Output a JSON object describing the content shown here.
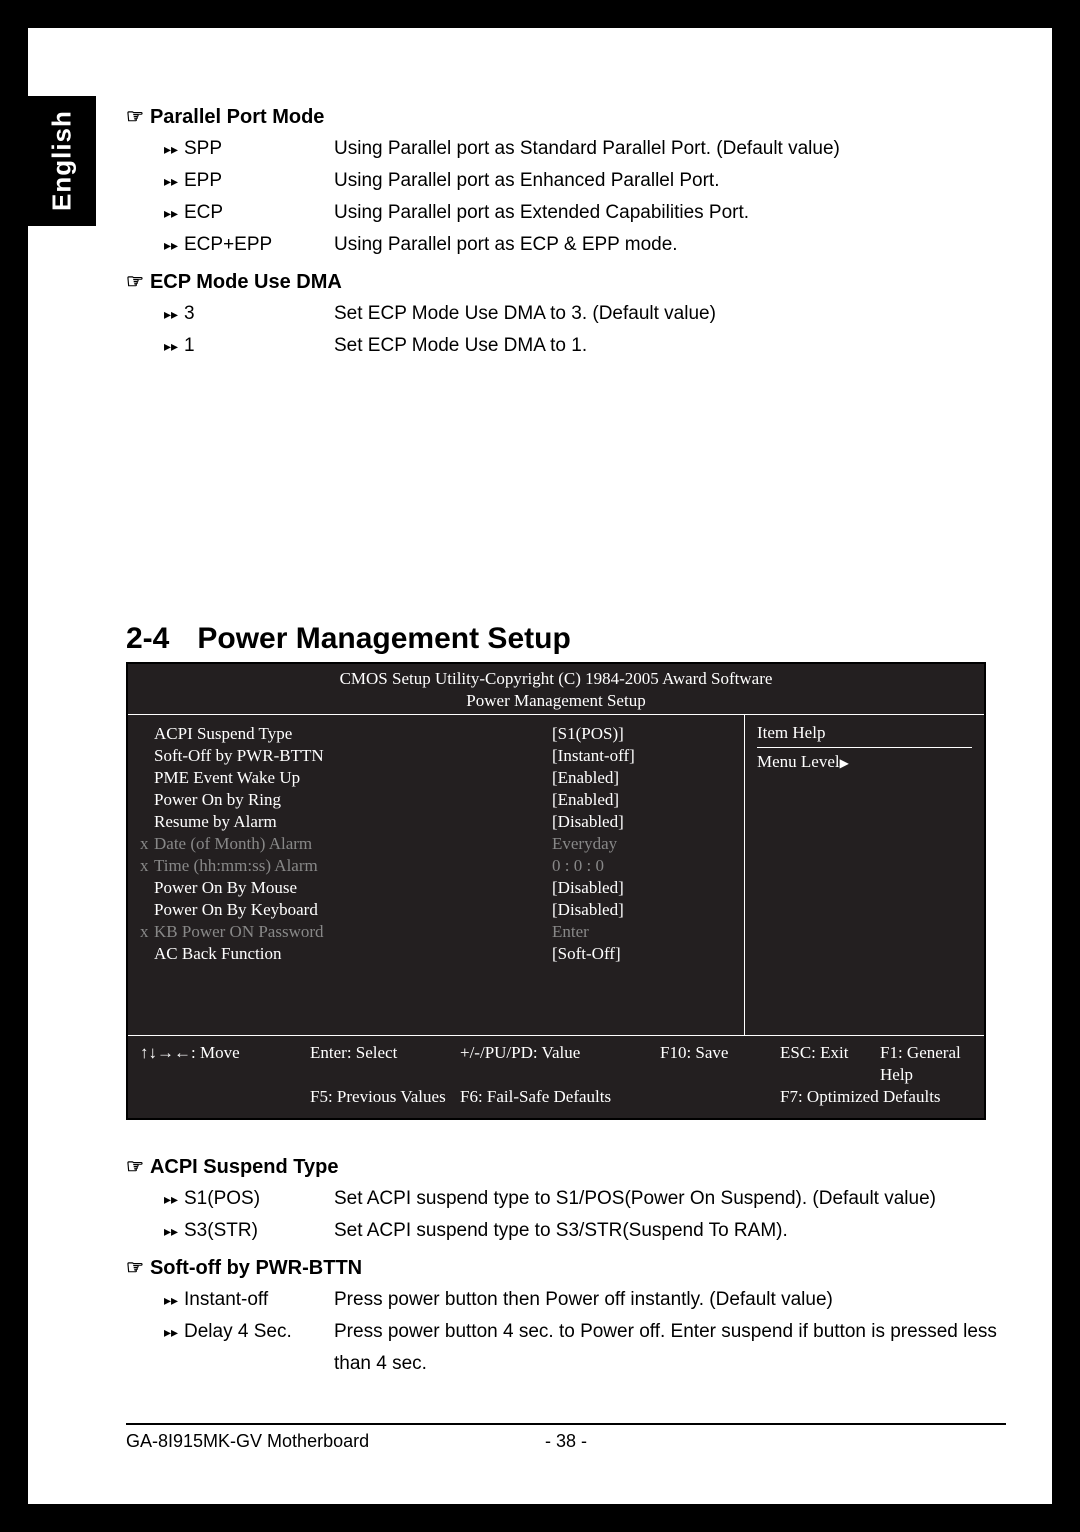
{
  "langTab": "English",
  "sections": [
    {
      "title": "Parallel Port Mode",
      "options": [
        {
          "label": "SPP",
          "desc": "Using Parallel port as Standard Parallel Port. (Default value)"
        },
        {
          "label": "EPP",
          "desc": "Using Parallel port as Enhanced Parallel Port."
        },
        {
          "label": "ECP",
          "desc": "Using Parallel port as Extended Capabilities Port."
        },
        {
          "label": "ECP+EPP",
          "desc": "Using Parallel port as ECP & EPP mode."
        }
      ]
    },
    {
      "title": "ECP Mode Use DMA",
      "options": [
        {
          "label": "3",
          "desc": "Set ECP Mode Use DMA to 3. (Default value)"
        },
        {
          "label": "1",
          "desc": "Set ECP Mode Use DMA to 1."
        }
      ]
    }
  ],
  "chapter": {
    "num": "2-4",
    "title": "Power Management Setup"
  },
  "bios": {
    "header1": "CMOS Setup Utility-Copyright (C) 1984-2005 Award Software",
    "header2": "Power Management Setup",
    "items": [
      {
        "x": false,
        "name": "ACPI Suspend Type",
        "value": "[S1(POS)]",
        "dim": false
      },
      {
        "x": false,
        "name": "Soft-Off by PWR-BTTN",
        "value": "[Instant-off]",
        "dim": false
      },
      {
        "x": false,
        "name": "PME Event Wake Up",
        "value": "[Enabled]",
        "dim": false
      },
      {
        "x": false,
        "name": "Power On by Ring",
        "value": "[Enabled]",
        "dim": false
      },
      {
        "x": false,
        "name": "Resume by Alarm",
        "value": "[Disabled]",
        "dim": false
      },
      {
        "x": true,
        "name": "Date (of Month) Alarm",
        "value": "Everyday",
        "dim": true
      },
      {
        "x": true,
        "name": "Time (hh:mm:ss) Alarm",
        "value": "0 : 0 : 0",
        "dim": true
      },
      {
        "x": false,
        "name": "Power On By Mouse",
        "value": "[Disabled]",
        "dim": false
      },
      {
        "x": false,
        "name": "Power On By Keyboard",
        "value": "[Disabled]",
        "dim": false
      },
      {
        "x": true,
        "name": "KB Power ON Password",
        "value": "Enter",
        "dim": true
      },
      {
        "x": false,
        "name": "AC Back Function",
        "value": "[Soft-Off]",
        "dim": false
      }
    ],
    "help": {
      "title": "Item Help",
      "menu": "Menu Level"
    },
    "footer": {
      "r1c1": "↑↓→←: Move",
      "r1c2": "Enter: Select",
      "r1c3": "+/-/PU/PD: Value",
      "r1c4": "F10: Save",
      "r1c5": "ESC: Exit",
      "r1c6": "F1: General Help",
      "r2c1": "",
      "r2c2": "F5: Previous Values",
      "r2c3": "F6: Fail-Safe Defaults",
      "r2c4": "",
      "r2c5": "F7: Optimized Defaults",
      "r2c6": ""
    }
  },
  "postSections": [
    {
      "title": "ACPI Suspend Type",
      "options": [
        {
          "label": "S1(POS)",
          "desc": "Set ACPI suspend type to S1/POS(Power On Suspend). (Default value)"
        },
        {
          "label": "S3(STR)",
          "desc": "Set ACPI suspend type to S3/STR(Suspend To RAM)."
        }
      ]
    },
    {
      "title": "Soft-off by PWR-BTTN",
      "options": [
        {
          "label": "Instant-off",
          "desc": "Press power button then Power off instantly. (Default value)"
        },
        {
          "label": "Delay 4 Sec.",
          "desc": "Press power button 4 sec. to Power off. Enter suspend if button is pressed less than 4 sec."
        }
      ]
    }
  ],
  "footer": {
    "left": "GA-8I915MK-GV Motherboard",
    "center": "- 38 -"
  }
}
